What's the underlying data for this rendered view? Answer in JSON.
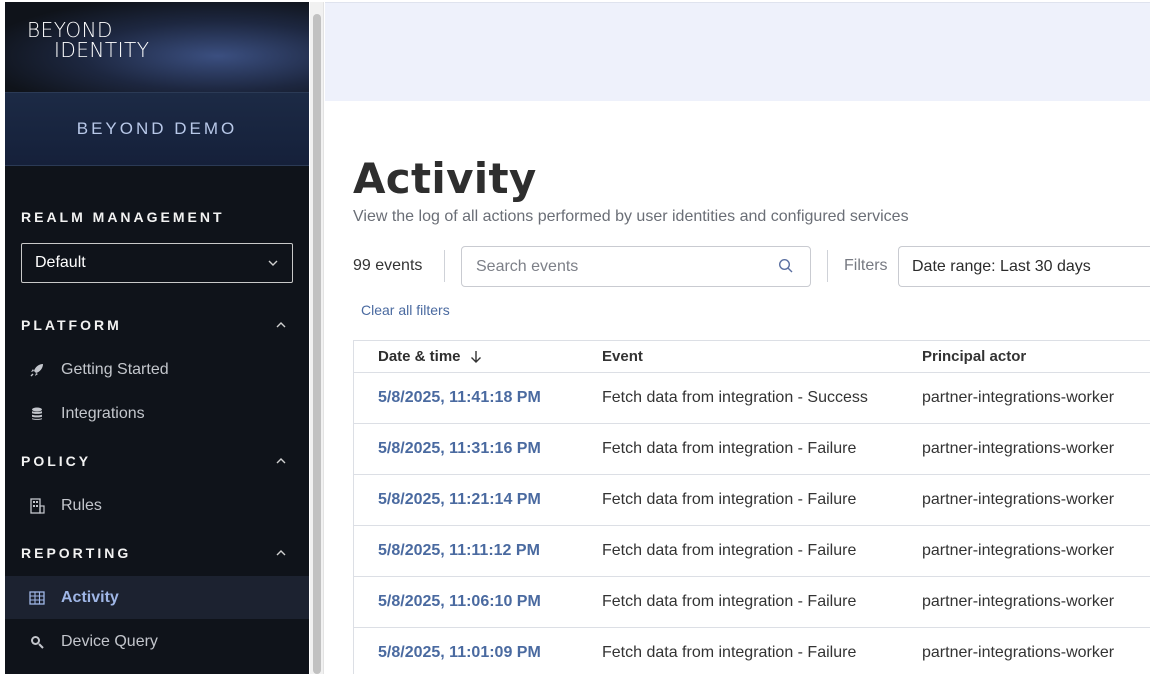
{
  "sidebar": {
    "logo_line1": "BEYOND",
    "logo_line2": "IDENTITY",
    "tenant": "BEYOND DEMO",
    "realm_title": "REALM MANAGEMENT",
    "realm_selected": "Default",
    "groups": [
      {
        "title": "PLATFORM",
        "items": [
          {
            "label": "Getting Started",
            "icon": "rocket-icon"
          },
          {
            "label": "Integrations",
            "icon": "database-icon"
          }
        ]
      },
      {
        "title": "POLICY",
        "items": [
          {
            "label": "Rules",
            "icon": "rules-icon"
          }
        ]
      },
      {
        "title": "REPORTING",
        "items": [
          {
            "label": "Activity",
            "icon": "table-icon",
            "active": true
          },
          {
            "label": "Device Query",
            "icon": "magnifier-icon"
          }
        ]
      }
    ]
  },
  "main": {
    "title": "Activity",
    "subtitle": "View the log of all actions performed by user identities and configured services",
    "count": "99 events",
    "search_placeholder": "Search events",
    "filters_label": "Filters",
    "date_range": "Date range: Last 30 days",
    "clear_filters": "Clear all filters",
    "table": {
      "headers": [
        "Date & time",
        "Event",
        "Principal actor"
      ],
      "rows": [
        [
          "5/8/2025, 11:41:18 PM",
          "Fetch data from integration - Success",
          "partner-integrations-worker"
        ],
        [
          "5/8/2025, 11:31:16 PM",
          "Fetch data from integration - Failure",
          "partner-integrations-worker"
        ],
        [
          "5/8/2025, 11:21:14 PM",
          "Fetch data from integration - Failure",
          "partner-integrations-worker"
        ],
        [
          "5/8/2025, 11:11:12 PM",
          "Fetch data from integration - Failure",
          "partner-integrations-worker"
        ],
        [
          "5/8/2025, 11:06:10 PM",
          "Fetch data from integration - Failure",
          "partner-integrations-worker"
        ],
        [
          "5/8/2025, 11:01:09 PM",
          "Fetch data from integration - Failure",
          "partner-integrations-worker"
        ]
      ]
    }
  },
  "colors": {
    "sidebar_bg": "#0f131a",
    "accent_link": "#4a6aa0",
    "active_nav": "#9fb6e6",
    "banner": "#eef1fb"
  }
}
